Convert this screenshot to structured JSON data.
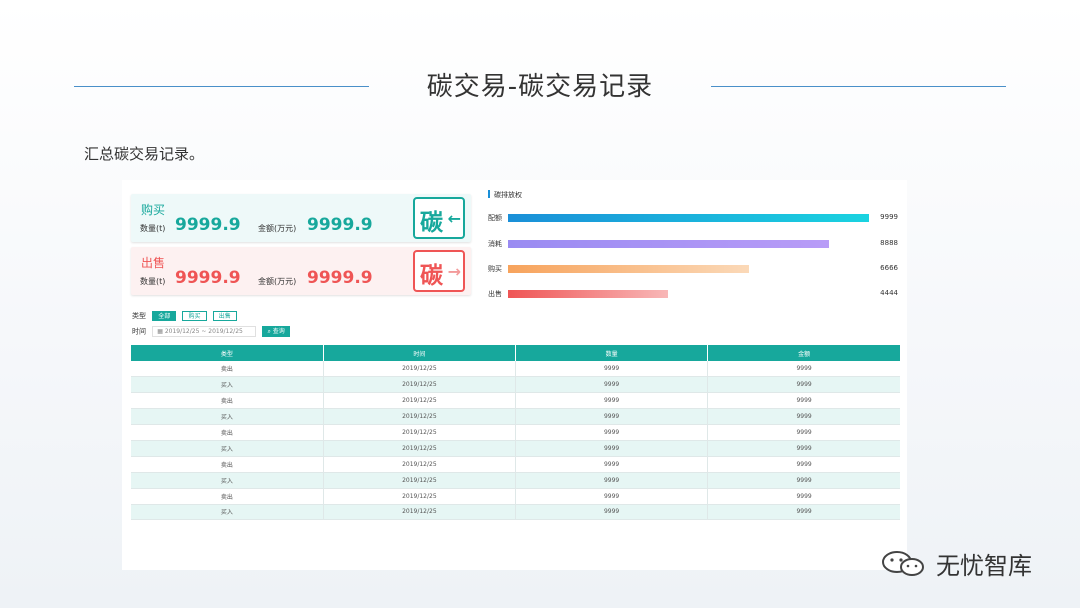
{
  "page": {
    "title": "碳交易-碳交易记录",
    "subtitle": "汇总碳交易记录。"
  },
  "cards": {
    "buy": {
      "title": "购买",
      "qty_label": "数量(t)",
      "qty_value": "9999.9",
      "amount_label": "金额(万元)",
      "amount_value": "9999.9",
      "icon_char": "碳",
      "icon_arrow": "←",
      "icon": "carbon-in-icon"
    },
    "sell": {
      "title": "出售",
      "qty_label": "数量(t)",
      "qty_value": "9999.9",
      "amount_label": "金额(万元)",
      "amount_value": "9999.9",
      "icon_char": "碳",
      "icon_arrow": "→",
      "icon": "carbon-out-icon"
    }
  },
  "bar_panel": {
    "title": "碳排放权",
    "max": 9999,
    "rows": [
      {
        "label": "配额",
        "value": 9999,
        "display": "9999",
        "color_from": "#1a8fd8",
        "color_to": "#1ad3e0"
      },
      {
        "label": "消耗",
        "value": 8888,
        "display": "8888",
        "color_from": "#9a8bf2",
        "color_to": "#b89cf7"
      },
      {
        "label": "购买",
        "value": 6666,
        "display": "6666",
        "color_from": "#f7a35c",
        "color_to": "#fbd9b8"
      },
      {
        "label": "出售",
        "value": 4444,
        "display": "4444",
        "color_from": "#ef5555",
        "color_to": "#f8b7b7"
      }
    ]
  },
  "filters": {
    "type_label": "类型",
    "chips": [
      {
        "label": "全部",
        "active": true
      },
      {
        "label": "购买",
        "active": false
      },
      {
        "label": "出售",
        "active": false
      }
    ],
    "time_label": "时间",
    "date_range": "2019/12/25 ~ 2019/12/25",
    "query_label": "查询"
  },
  "table": {
    "headers": [
      "类型",
      "时间",
      "数量",
      "金额"
    ],
    "rows": [
      [
        "卖出",
        "2019/12/25",
        "9999",
        "9999"
      ],
      [
        "买入",
        "2019/12/25",
        "9999",
        "9999"
      ],
      [
        "卖出",
        "2019/12/25",
        "9999",
        "9999"
      ],
      [
        "买入",
        "2019/12/25",
        "9999",
        "9999"
      ],
      [
        "卖出",
        "2019/12/25",
        "9999",
        "9999"
      ],
      [
        "买入",
        "2019/12/25",
        "9999",
        "9999"
      ],
      [
        "卖出",
        "2019/12/25",
        "9999",
        "9999"
      ],
      [
        "买入",
        "2019/12/25",
        "9999",
        "9999"
      ],
      [
        "卖出",
        "2019/12/25",
        "9999",
        "9999"
      ],
      [
        "买入",
        "2019/12/25",
        "9999",
        "9999"
      ]
    ]
  },
  "watermark": {
    "text": "无忧智库",
    "icon": "wechat-icon"
  },
  "colors": {
    "accent": "#17a89c",
    "sell": "#ef5555",
    "title_line": "#4a90c9"
  }
}
